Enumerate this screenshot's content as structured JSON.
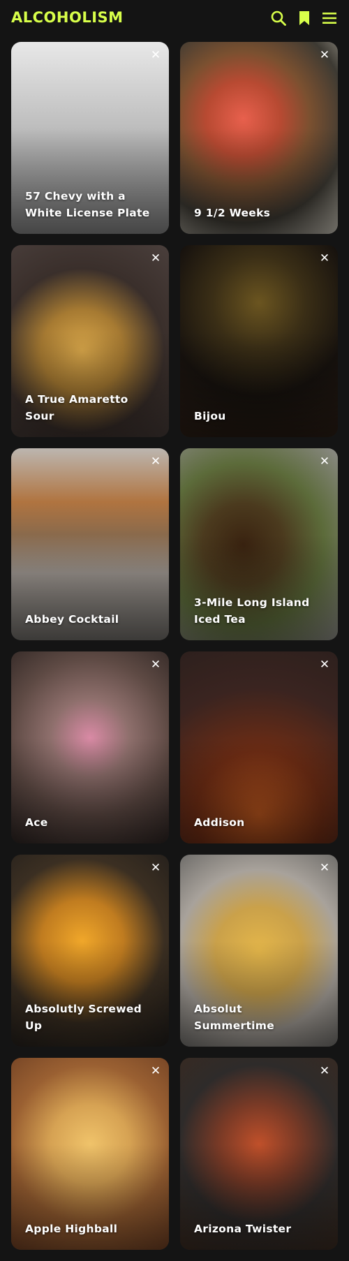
{
  "header": {
    "logo": "ALCOHOLISM",
    "accent": "#d8ff4a",
    "icons": [
      "search-icon",
      "bookmark-icon",
      "menu-icon"
    ]
  },
  "cards": [
    {
      "title": "57 Chevy with a White License Plate",
      "close": "✕",
      "bg": "linear-gradient(180deg,#e8e8e8 0%,#bdbdbd 45%,#7e7e7e 100%)"
    },
    {
      "title": "9 1/2 Weeks",
      "close": "✕",
      "bg": "radial-gradient(circle at 40% 40%,#e8604d 0%,#b84a32 25%,#7a5030 45%,#3d3a33 70%,#c9c4b8 100%)"
    },
    {
      "title": "A True Amaretto Sour",
      "close": "✕",
      "bg": "radial-gradient(circle at 45% 55%,#d9a74a 0%,#a67a32 30%,#3a2f2b 60%,#4a3f3c 100%)"
    },
    {
      "title": "Bijou",
      "close": "✕",
      "bg": "radial-gradient(circle at 50% 30%,#6b5520 0%,#3a2e16 30%,#17120e 60%,#2a1d14 100%)"
    },
    {
      "title": "Abbey Cocktail",
      "close": "✕",
      "bg": "linear-gradient(180deg,#bcb6b0 0%,#b07440 28%,#8a6a4c 45%,#9d9690 65%,#6d6a66 100%)"
    },
    {
      "title": "3-Mile Long Island Iced Tea",
      "close": "✕",
      "bg": "radial-gradient(circle at 40% 50%,#3a2310 0%,#4b3a1e 30%,#5c6b3a 60%,#8b8a86 100%)"
    },
    {
      "title": "Ace",
      "close": "✕",
      "bg": "radial-gradient(circle at 50% 45%,#d98aa5 0%,#8e6f6c 30%,#5e4a44 60%,#2a2220 100%)"
    },
    {
      "title": "Addison",
      "close": "✕",
      "bg": "radial-gradient(circle at 50% 85%,#b8551d 0%,#6d2c14 35%,#3a2420 70%,#2d201d 100%)"
    },
    {
      "title": "Absolutly Screwed Up",
      "close": "✕",
      "bg": "radial-gradient(circle at 45% 45%,#f0a72a 0%,#c07c20 30%,#3b2f22 60%,#1f1c1a 100%)"
    },
    {
      "title": "Absolut Summertime",
      "close": "✕",
      "bg": "radial-gradient(circle at 50% 50%,#e4b64a 0%,#caa14a 35%,#a8a29b 65%,#6f6d6a 100%)"
    },
    {
      "title": "Apple Highball",
      "close": "✕",
      "bg": "radial-gradient(circle at 50% 45%,#f0c36a 0%,#d6a253 30%,#9a6032 60%,#6b3d22 100%)"
    },
    {
      "title": "Arizona Twister",
      "close": "✕",
      "bg": "radial-gradient(circle at 50% 45%,#c0502a 0%,#7a3a26 30%,#2e2b2a 60%,#3a2a20 100%)"
    }
  ]
}
